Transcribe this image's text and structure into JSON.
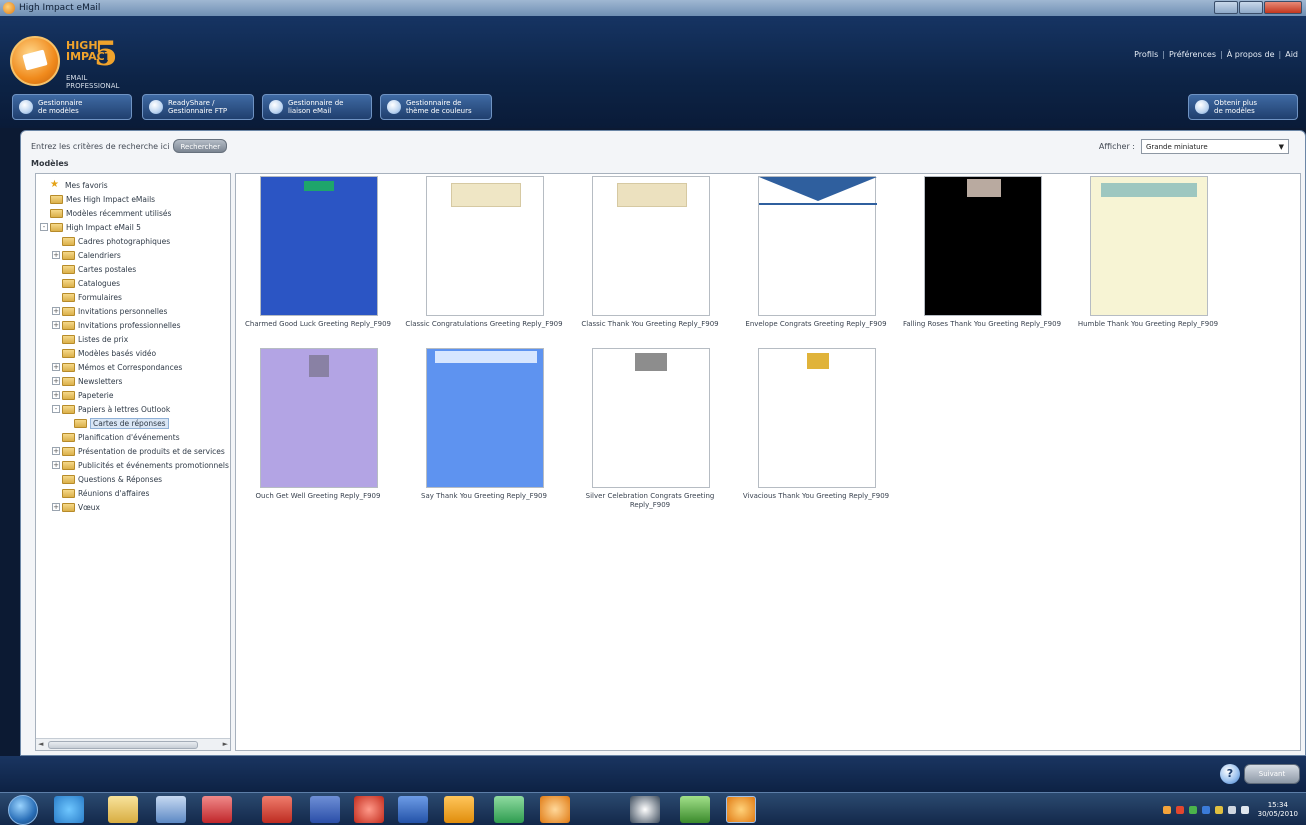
{
  "window": {
    "title": "High Impact eMail"
  },
  "logo": {
    "line1": "HIGH",
    "line2": "IMPACT",
    "five": "5",
    "sub1": "EMAIL",
    "sub2": "PROFESSIONAL"
  },
  "top_links": {
    "profile": "Profils",
    "preferences": "Préférences",
    "about": "À propos de",
    "help": "Aid"
  },
  "toolbar": {
    "templates": "Gestionnaire\nde modèles",
    "readyshare": "ReadyShare /\nGestionnaire FTP",
    "email_manager": "Gestionnaire de\nliaison eMail",
    "color_manager": "Gestionnaire de\nthème de couleurs",
    "get_more": "Obtenir plus\nde modèles"
  },
  "search": {
    "label": "Entrez les critères de recherche ici",
    "button": "Rechercher"
  },
  "models_label": "Modèles",
  "display": {
    "label": "Afficher :",
    "value": "Grande miniature"
  },
  "tree": [
    {
      "label": "Mes favoris",
      "type": "star",
      "depth": 0,
      "exp": ""
    },
    {
      "label": "Mes High Impact eMails",
      "type": "folder",
      "depth": 0,
      "exp": ""
    },
    {
      "label": "Modèles récemment utilisés",
      "type": "folder",
      "depth": 0,
      "exp": ""
    },
    {
      "label": "High Impact eMail 5",
      "type": "folder",
      "depth": 0,
      "exp": "-"
    },
    {
      "label": "Cadres photographiques",
      "type": "folder",
      "depth": 1,
      "exp": ""
    },
    {
      "label": "Calendriers",
      "type": "folder",
      "depth": 1,
      "exp": "+"
    },
    {
      "label": "Cartes postales",
      "type": "folder",
      "depth": 1,
      "exp": ""
    },
    {
      "label": "Catalogues",
      "type": "folder",
      "depth": 1,
      "exp": ""
    },
    {
      "label": "Formulaires",
      "type": "folder",
      "depth": 1,
      "exp": ""
    },
    {
      "label": "Invitations personnelles",
      "type": "folder",
      "depth": 1,
      "exp": "+"
    },
    {
      "label": "Invitations professionnelles",
      "type": "folder",
      "depth": 1,
      "exp": "+"
    },
    {
      "label": "Listes de prix",
      "type": "folder",
      "depth": 1,
      "exp": ""
    },
    {
      "label": "Modèles basés vidéo",
      "type": "folder",
      "depth": 1,
      "exp": ""
    },
    {
      "label": "Mémos et Correspondances",
      "type": "folder",
      "depth": 1,
      "exp": "+"
    },
    {
      "label": "Newsletters",
      "type": "folder",
      "depth": 1,
      "exp": "+"
    },
    {
      "label": "Papeterie",
      "type": "folder",
      "depth": 1,
      "exp": "+"
    },
    {
      "label": "Papiers à lettres Outlook",
      "type": "folder",
      "depth": 1,
      "exp": "-"
    },
    {
      "label": "Cartes de réponses",
      "type": "folder",
      "depth": 2,
      "exp": "",
      "selected": true
    },
    {
      "label": "Planification d'événements",
      "type": "folder",
      "depth": 1,
      "exp": ""
    },
    {
      "label": "Présentation de produits et de services",
      "type": "folder",
      "depth": 1,
      "exp": "+"
    },
    {
      "label": "Publicités et événements promotionnels",
      "type": "folder",
      "depth": 1,
      "exp": "+"
    },
    {
      "label": "Questions & Réponses",
      "type": "folder",
      "depth": 1,
      "exp": ""
    },
    {
      "label": "Réunions d'affaires",
      "type": "folder",
      "depth": 1,
      "exp": ""
    },
    {
      "label": "Vœux",
      "type": "folder",
      "depth": 1,
      "exp": "+"
    }
  ],
  "templates": [
    {
      "name": "Charmed Good Luck Greeting Reply_F909",
      "bg": "#2b55c4",
      "accent": "#1ea56b",
      "style": "blue"
    },
    {
      "name": "Classic Congratulations Greeting Reply_F909",
      "bg": "#ffffff",
      "accent": "#efe6c5",
      "style": "banner"
    },
    {
      "name": "Classic Thank You Greeting Reply_F909",
      "bg": "#ffffff",
      "accent": "#ece1bf",
      "style": "card"
    },
    {
      "name": "Envelope Congrats Greeting Reply_F909",
      "bg": "#ffffff",
      "accent": "#2f5f9e",
      "style": "envelope"
    },
    {
      "name": "Falling Roses Thank You Greeting Reply_F909",
      "bg": "#000000",
      "accent": "#b9aaa0",
      "style": "dark"
    },
    {
      "name": "Humble Thank You Greeting Reply_F909",
      "bg": "#f7f4d4",
      "accent": "#9ec7c0",
      "style": "humble"
    },
    {
      "name": "Ouch Get Well Greeting Reply_F909",
      "bg": "#b3a4e4",
      "accent": "#6d6a7a",
      "style": "lavender"
    },
    {
      "name": "Say Thank You Greeting Reply_F909",
      "bg": "#5e93f0",
      "accent": "#d7e6ff",
      "style": "sky"
    },
    {
      "name": "Silver Celebration Congrats Greeting Reply_F909",
      "bg": "#ffffff",
      "accent": "#8d8d8d",
      "style": "silver"
    },
    {
      "name": "Vivacious Thank You Greeting Reply_F909",
      "bg": "#ffffff",
      "accent": "#e0b33a",
      "style": "vivacious"
    }
  ],
  "bottom": {
    "help": "?",
    "submit": "Suivant"
  },
  "clock": {
    "time": "15:34",
    "date": "30/05/2010"
  }
}
